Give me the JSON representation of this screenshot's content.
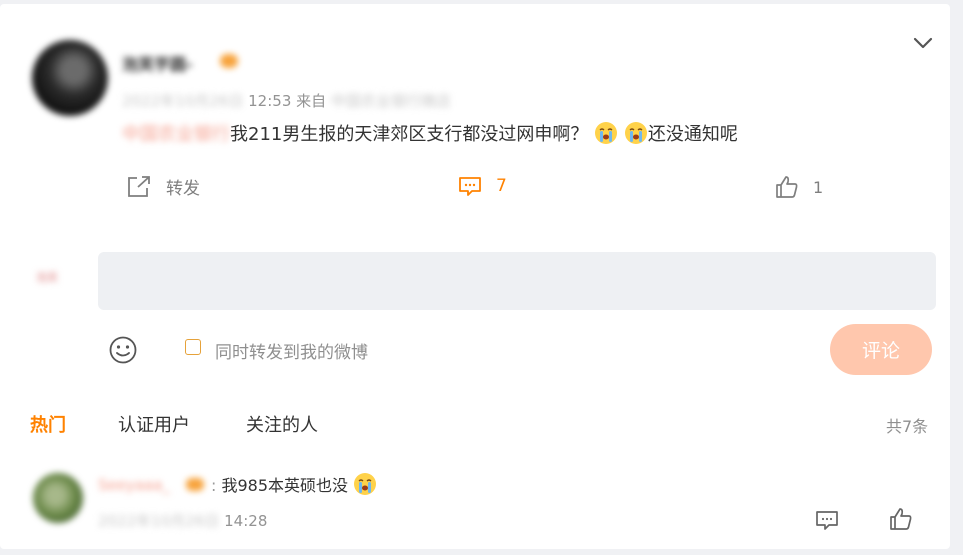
{
  "post": {
    "author": "泡芙芋圆-",
    "date_blurred": "2022年10月26日",
    "time": "12:53",
    "source_prefix": "来自",
    "source_blurred": "中国农业银行微店",
    "mention_blurred": "中国农业银行",
    "text_1": "我211男生报的天津郊区支行都没过网申啊？",
    "text_2": "还没通知呢",
    "emoji": "crying-emoji"
  },
  "actions": {
    "repost_label": "转发",
    "comment_count": "7",
    "like_count": "1"
  },
  "composer": {
    "avatar_text": "泡芙",
    "sync_label": "同时转发到我的微博",
    "submit_label": "评论"
  },
  "tabs": [
    "热门",
    "认证用户",
    "关注的人"
  ],
  "total_label": "共7条",
  "reply": {
    "author": "Seeyaaa_",
    "text": "我985本英硕也没",
    "date_blurred": "2022年10月26日",
    "time": "14:28"
  },
  "colors": {
    "accent": "#ff8200",
    "submit_bg": "#ffc7ad",
    "input_bg": "#eef0f3"
  }
}
